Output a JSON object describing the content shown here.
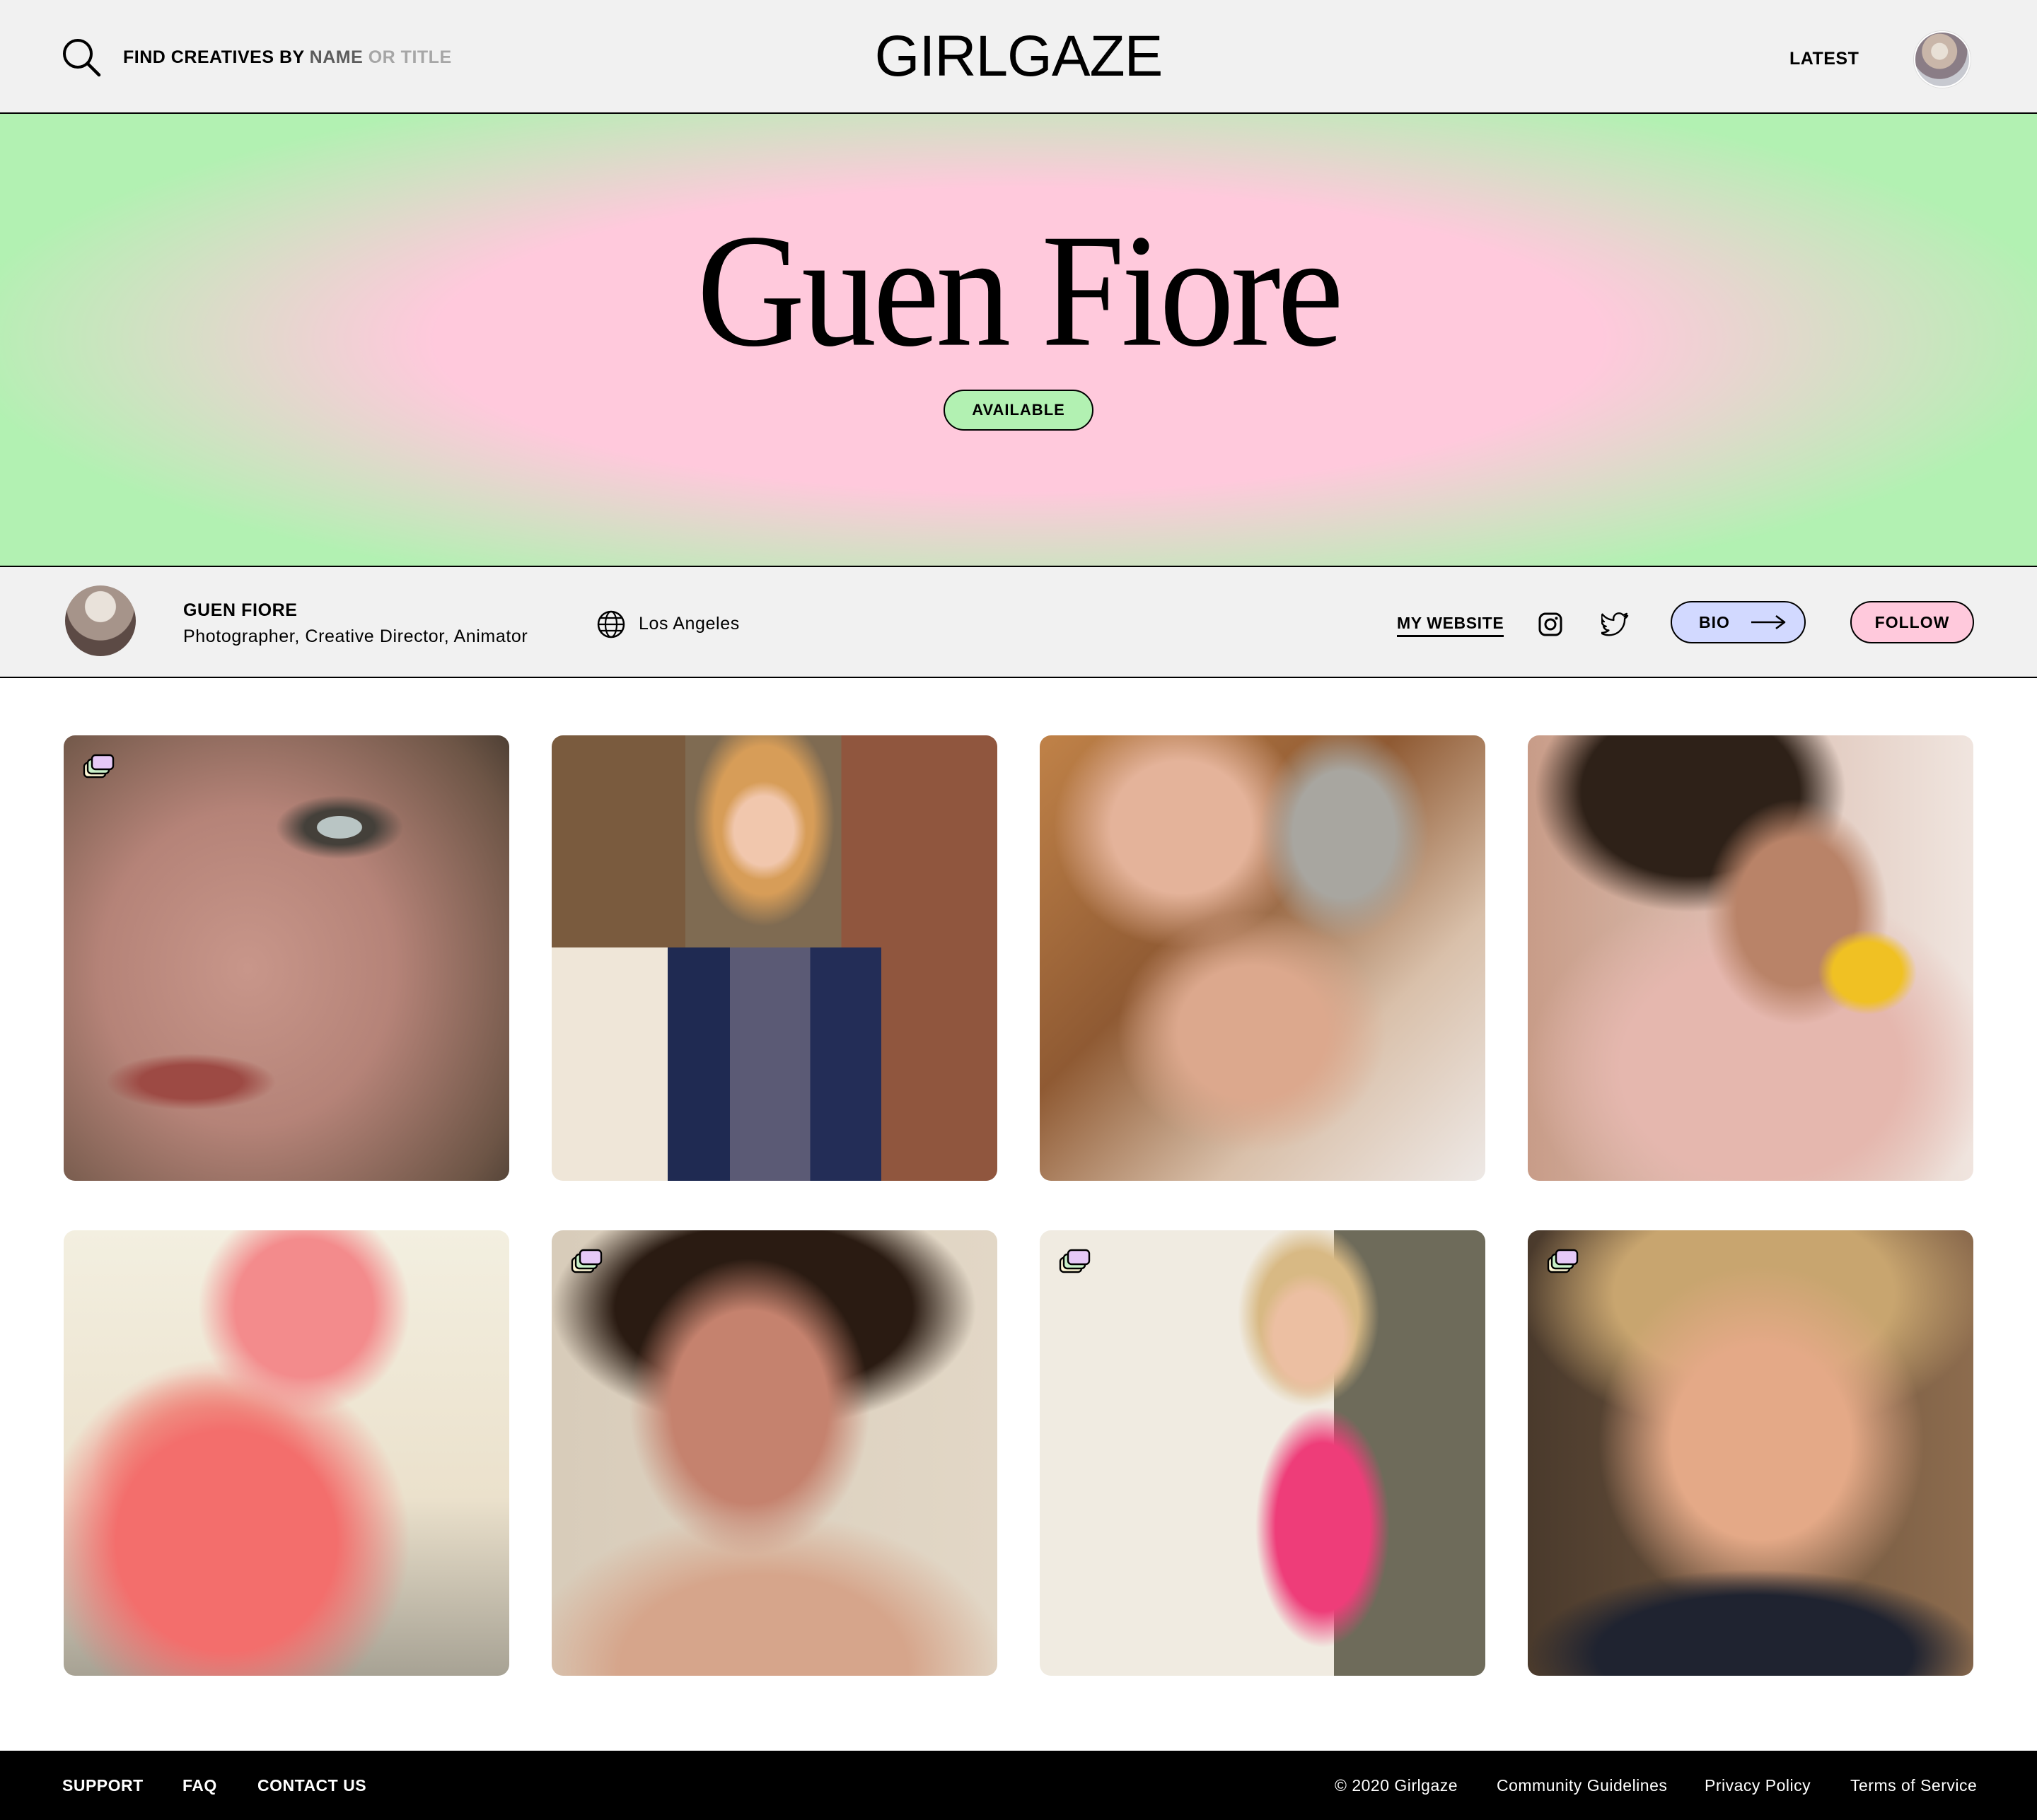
{
  "header": {
    "search": {
      "part1": "FIND CREATIVES BY",
      "part2": "NAME",
      "part3": "OR TITLE"
    },
    "logo": "GIRLGAZE",
    "nav_latest": "LATEST",
    "icons": {
      "search": "search-icon",
      "avatar": "user-avatar"
    }
  },
  "hero": {
    "name": "Guen Fiore",
    "status_badge": "AVAILABLE",
    "colors": {
      "center": "#ffc9dc",
      "edge": "#b2f1b2"
    }
  },
  "profile": {
    "name": "GUEN FIORE",
    "roles": "Photographer, Creative Director, Animator",
    "location": "Los Angeles",
    "website_label": "MY WEBSITE",
    "bio_label": "BIO",
    "follow_label": "FOLLOW",
    "icons": [
      "globe-icon",
      "instagram-icon",
      "twitter-icon",
      "arrow-right-icon"
    ],
    "colors": {
      "bio_button": "#d2d9ff",
      "follow_button": "#ffc9dc"
    }
  },
  "gallery": {
    "items": [
      {
        "subject": "close-up freckled face",
        "multi_image": true
      },
      {
        "subject": "smiling girl with braids",
        "multi_image": false
      },
      {
        "subject": "three faces together",
        "multi_image": false
      },
      {
        "subject": "embracing pair",
        "multi_image": false
      },
      {
        "subject": "pink towel",
        "multi_image": false
      },
      {
        "subject": "portrait with earring",
        "multi_image": true
      },
      {
        "subject": "pink swimsuit",
        "multi_image": true
      },
      {
        "subject": "hand on cheek portrait",
        "multi_image": true
      }
    ]
  },
  "footer": {
    "support": "SUPPORT",
    "faq": "FAQ",
    "contact": "CONTACT US",
    "copyright": "© 2020 Girlgaze",
    "guidelines": "Community Guidelines",
    "privacy": "Privacy Policy",
    "terms": "Terms of Service"
  }
}
